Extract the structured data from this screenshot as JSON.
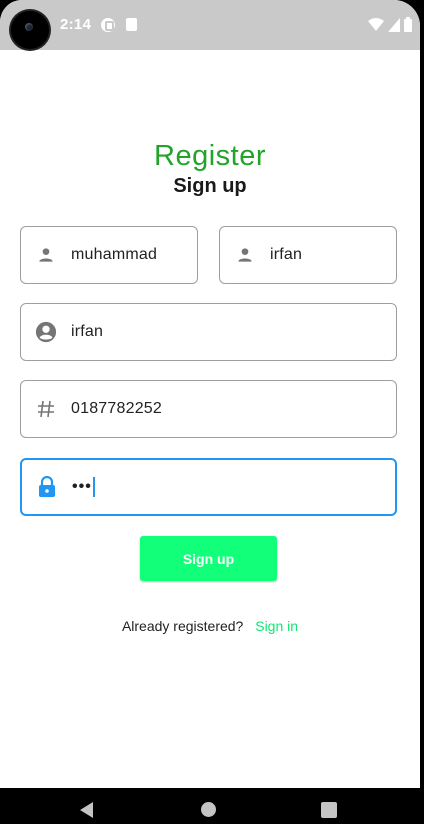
{
  "status_bar": {
    "time": "2:14"
  },
  "header": {
    "title": "Register",
    "subtitle": "Sign up"
  },
  "form": {
    "first_name": "muhammad",
    "last_name": "irfan",
    "username": "irfan",
    "phone": "0187782252",
    "password_masked": "•••"
  },
  "actions": {
    "signup_label": "Sign up",
    "already_text": "Already registered?",
    "signin_label": "Sign in"
  },
  "colors": {
    "title_green": "#22a32a",
    "button_green": "#12ff7a",
    "link_green": "#12e672",
    "focus_blue": "#2196f3"
  },
  "icons": {
    "first_name": "person-icon",
    "last_name": "person-icon",
    "username": "account-circle-icon",
    "phone": "hash-icon",
    "password": "lock-icon"
  }
}
